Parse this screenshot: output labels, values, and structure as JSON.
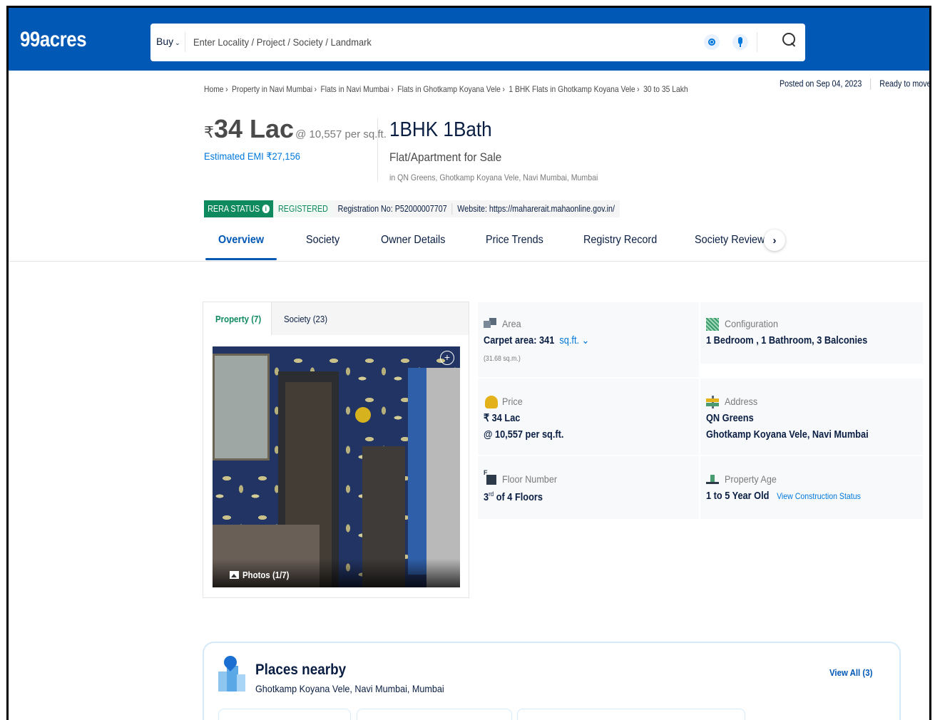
{
  "header": {
    "logo": "99acres",
    "buy_label": "Buy",
    "search_placeholder": "Enter Locality / Project / Society / Landmark"
  },
  "breadcrumb": [
    "Home",
    "Property in Navi Mumbai",
    "Flats in Navi Mumbai",
    "Flats in Ghotkamp Koyana Vele",
    "1 BHK Flats in Ghotkamp Koyana Vele",
    "30 to 35 Lakh"
  ],
  "posted": {
    "date": "Posted on Sep 04, 2023",
    "status": "Ready to move"
  },
  "listing": {
    "currency": "₹",
    "price": "34 Lac",
    "per_sqft": "@ 10,557 per sq.ft.",
    "emi": "Estimated EMI ₹27,156",
    "bhk": "1BHK 1Bath",
    "type": "Flat/Apartment for Sale",
    "location": "in QN Greens, Ghotkamp Koyana Vele, Navi Mumbai, Mumbai"
  },
  "rera": {
    "status_label": "RERA STATUS",
    "status_value": "REGISTERED",
    "registration": "Registration No: P52000007707",
    "website": "Website: https://maharerait.mahaonline.gov.in/"
  },
  "tabs": [
    "Overview",
    "Society",
    "Owner Details",
    "Price Trends",
    "Registry Record",
    "Society Reviews"
  ],
  "gallery": {
    "tab_property": "Property (7)",
    "tab_society": "Society (23)",
    "photo_count": "Photos (1/7)"
  },
  "details": {
    "area": {
      "label": "Area",
      "value": "Carpet area: 341",
      "unit": "sq.ft.",
      "sub": "(31.68 sq.m.)"
    },
    "configuration": {
      "label": "Configuration",
      "value": "1 Bedroom , 1 Bathroom, 3 Balconies"
    },
    "price": {
      "label": "Price",
      "value": "₹ 34 Lac",
      "sub": "@ 10,557 per sq.ft."
    },
    "address": {
      "label": "Address",
      "value": "QN Greens",
      "sub": "Ghotkamp Koyana Vele, Navi Mumbai"
    },
    "floor": {
      "label": "Floor Number",
      "value_main": "3",
      "value_sup": "rd",
      "value_rest": " of 4 Floors"
    },
    "age": {
      "label": "Property Age",
      "value": "1 to 5 Year Old",
      "link": "View Construction Status"
    }
  },
  "places": {
    "title": "Places nearby",
    "subtitle": "Ghotkamp Koyana Vele, Navi Mumbai, Mumbai",
    "view_all": "View All (3)"
  },
  "colors": {
    "brand_blue": "#0258b5",
    "rera_green": "#0f8a5f",
    "link_blue": "#0078db"
  }
}
